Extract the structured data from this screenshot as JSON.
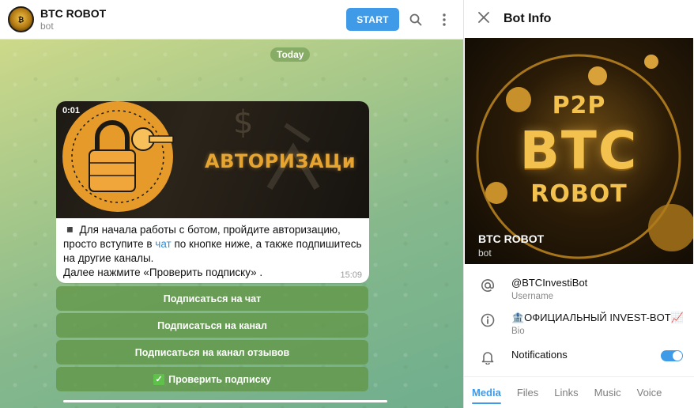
{
  "chat": {
    "title": "BTC ROBOT",
    "subtitle": "bot",
    "start_label": "START",
    "date_pill": "Today",
    "message": {
      "video_time": "0:01",
      "video_text": "АВТОРИЗАЦи",
      "text_part1": "◾ Для начала работы с ботом, пройдите авторизацию, просто вступите в ",
      "text_link": "чат",
      "text_part2": " по кнопке ниже, а также подпишитесь на другие каналы.",
      "text_line2": "Далее нажмите «Проверить подписку» .",
      "time": "15:09"
    },
    "buttons": [
      {
        "label": "Подписаться на чат"
      },
      {
        "label": "Подписаться на канал"
      },
      {
        "label": "Подписаться на канал отзывов"
      },
      {
        "label": "Проверить подписку",
        "icon": "✓"
      }
    ]
  },
  "info": {
    "title": "Bot Info",
    "cover": {
      "line1": "P2P",
      "line2": "BTC",
      "line3": "ROBOT",
      "name": "BTC ROBOT",
      "subtitle": "bot"
    },
    "username": {
      "value": "@BTCInvestiBot",
      "label": "Username"
    },
    "bio": {
      "value": "🏦ОФИЦИАЛЬНЫЙ INVEST-BOT📈",
      "label": "Bio"
    },
    "notifications": {
      "label": "Notifications",
      "enabled": true
    },
    "tabs": [
      "Media",
      "Files",
      "Links",
      "Music",
      "Voice"
    ]
  },
  "colors": {
    "accent": "#3f9ae8",
    "button_green": "#62964a"
  }
}
